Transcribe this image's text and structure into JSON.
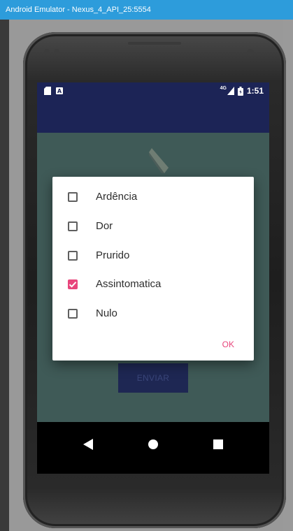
{
  "window": {
    "title": "Android Emulator - Nexus_4_API_25:5554"
  },
  "statusbar": {
    "network": "4G",
    "time": "1:51"
  },
  "dialog": {
    "options": [
      {
        "label": "Ardência",
        "checked": false
      },
      {
        "label": "Dor",
        "checked": false
      },
      {
        "label": "Prurido",
        "checked": false
      },
      {
        "label": "Assintomatica",
        "checked": true
      },
      {
        "label": "Nulo",
        "checked": false
      }
    ],
    "ok_label": "OK"
  },
  "content": {
    "submit_label": "ENVIAR"
  },
  "colors": {
    "accent": "#e8467c",
    "primary_dark": "#1c2456",
    "content_bg": "#3f5a57",
    "titlebar": "#2d9cdb"
  }
}
